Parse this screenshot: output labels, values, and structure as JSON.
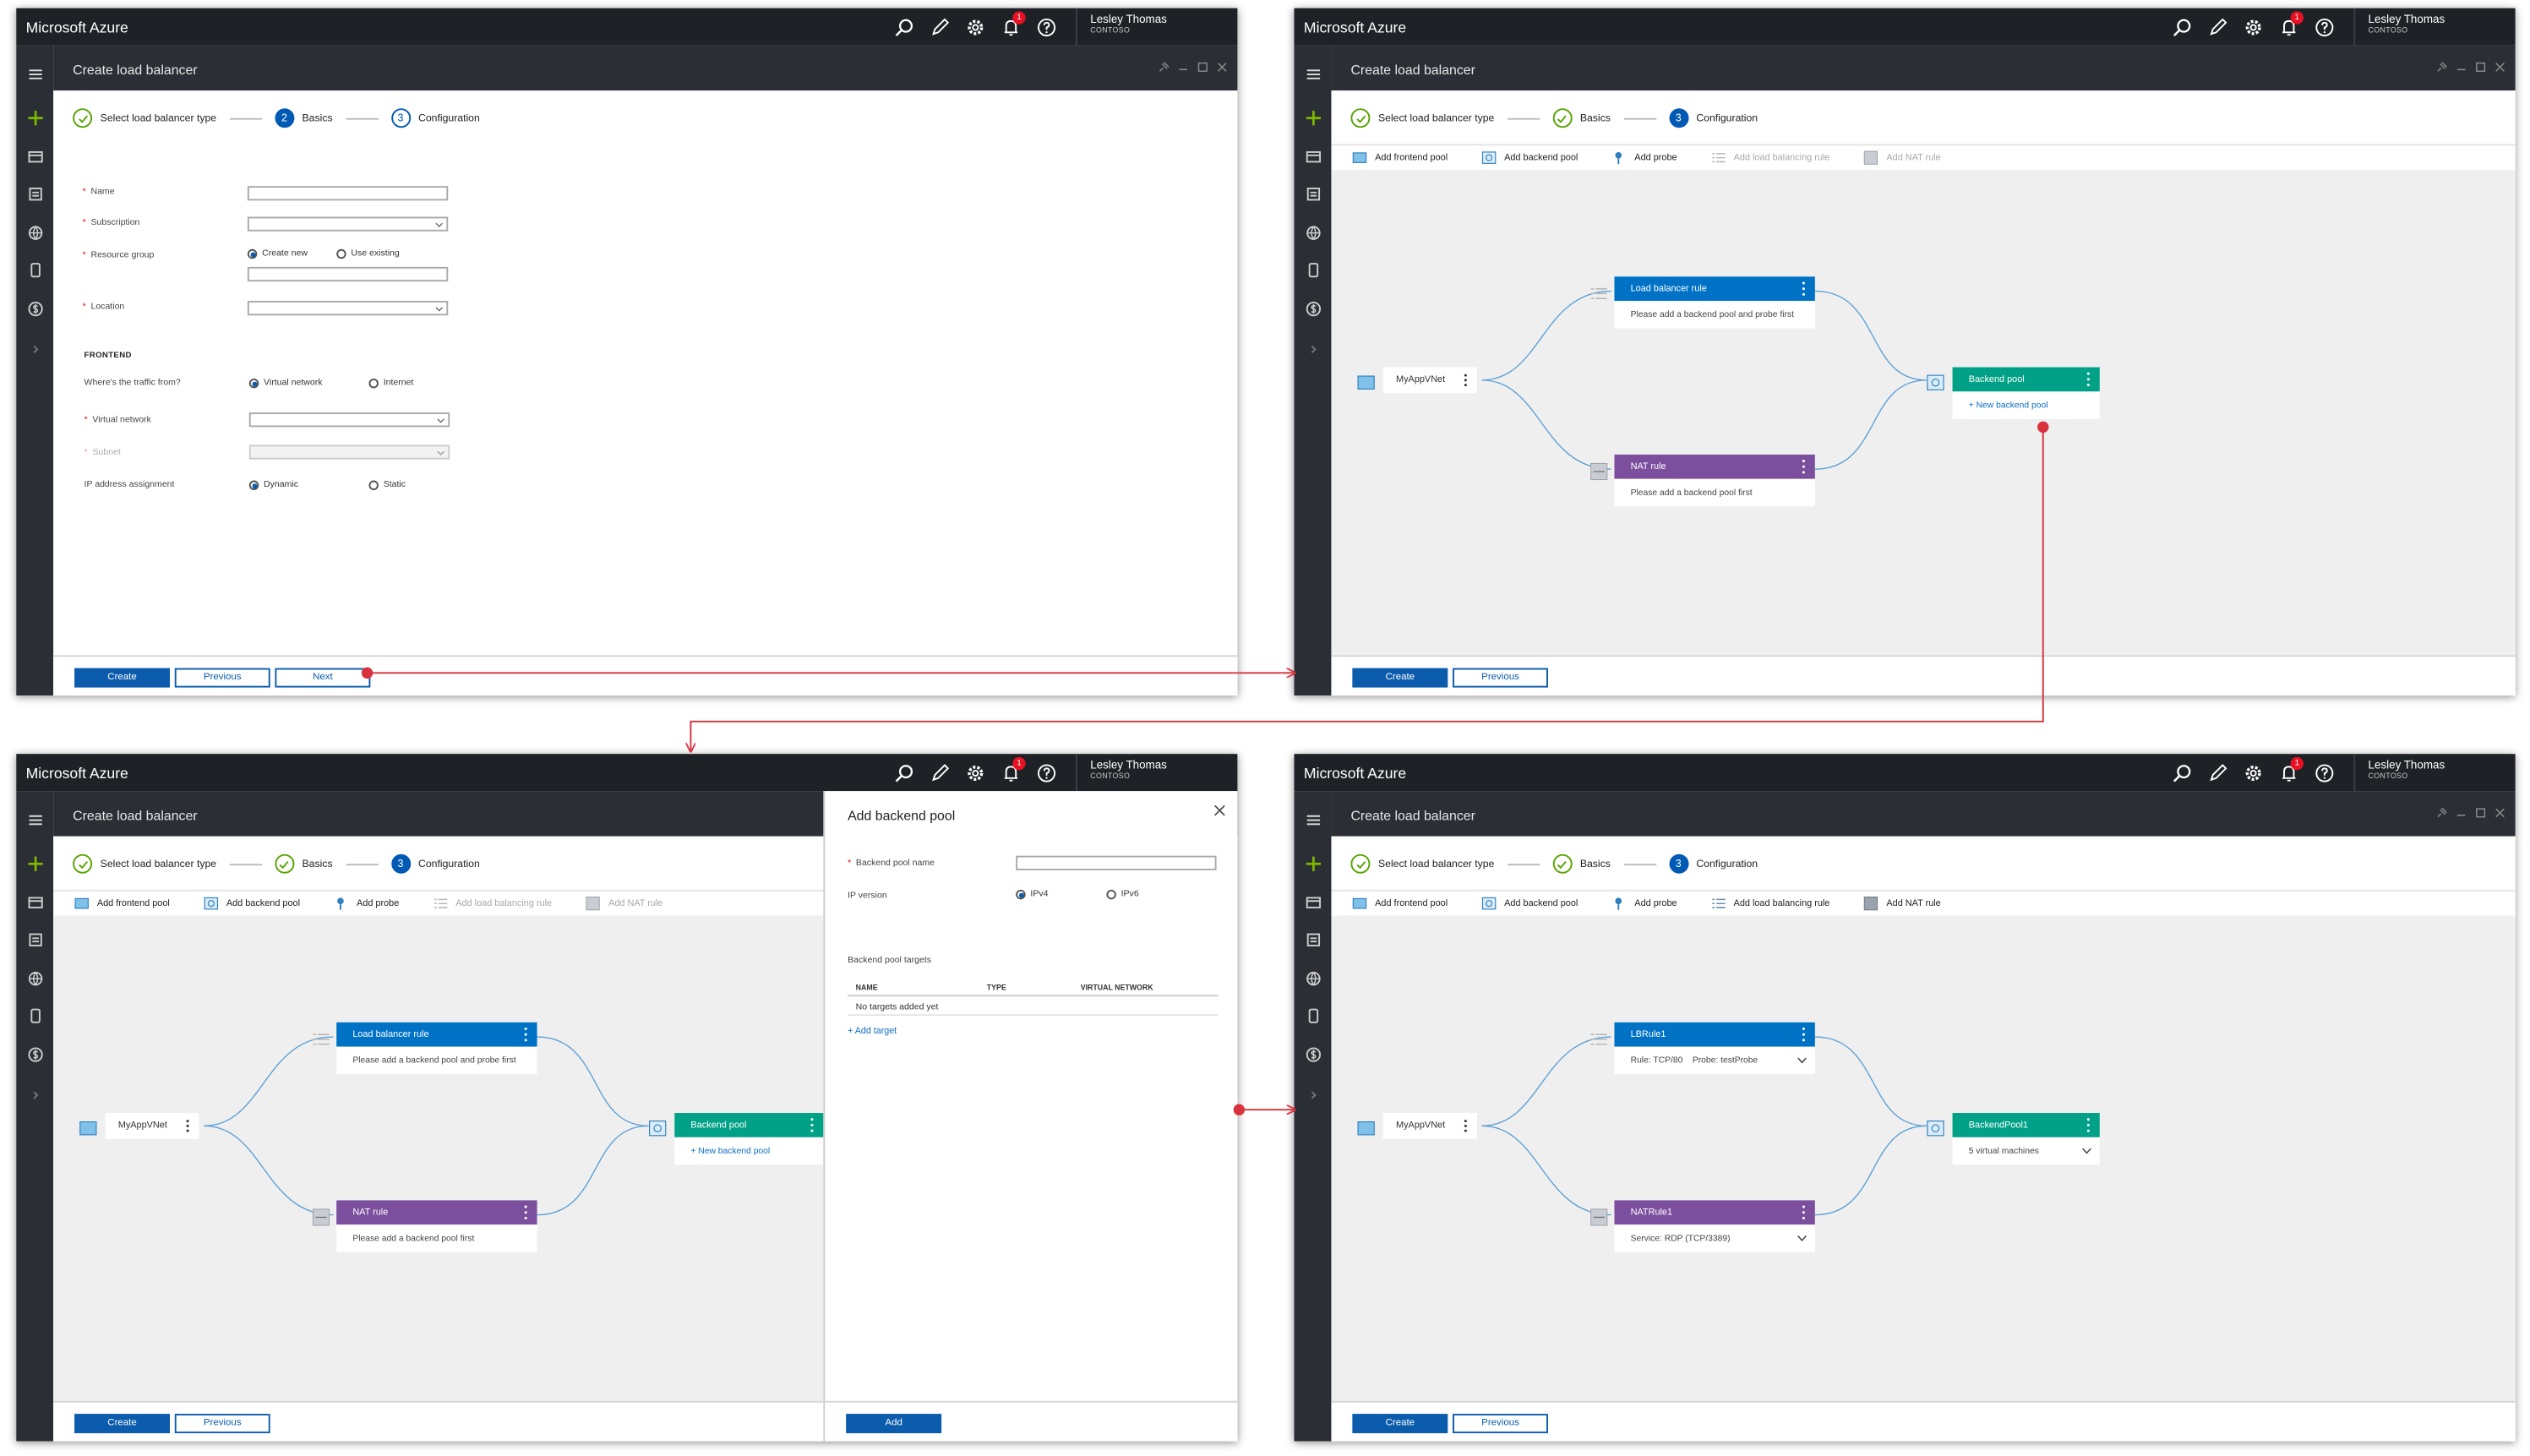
{
  "shell": {
    "brand": "Microsoft Azure",
    "notification_count": "1",
    "user_name": "Lesley Thomas",
    "user_tenant": "CONTOSO",
    "blade_title": "Create load balancer"
  },
  "steps": {
    "step1": "Select load balancer type",
    "step2": "Basics",
    "step3": "Configuration",
    "step2_number": "2",
    "step3_number": "3"
  },
  "form": {
    "name_label": "Name",
    "subscription_label": "Subscription",
    "resource_group_label": "Resource group",
    "create_new": "Create new",
    "use_existing": "Use existing",
    "location_label": "Location",
    "section_frontend": "FRONTEND",
    "traffic_label": "Where's the traffic from?",
    "virtual_network_option": "Virtual network",
    "internet_option": "Internet",
    "virtual_network_label": "Virtual network",
    "subnet_label": "Subnet",
    "ip_assignment_label": "IP address assignment",
    "dynamic_option": "Dynamic",
    "static_option": "Static"
  },
  "toolbar": {
    "add_frontend_pool": "Add frontend pool",
    "add_backend_pool": "Add backend pool",
    "add_probe": "Add probe",
    "add_lb_rule": "Add load balancing rule",
    "add_nat_rule": "Add NAT rule"
  },
  "buttons": {
    "create": "Create",
    "previous": "Previous",
    "next": "Next",
    "add": "Add"
  },
  "diagram": {
    "vnet_name": "MyAppVNet",
    "lb_rule_title": "Load balancer rule",
    "lb_rule_note": "Please add a backend pool and probe first",
    "nat_rule_title": "NAT rule",
    "nat_rule_note": "Please add a backend pool first",
    "backend_pool_title": "Backend pool",
    "new_backend_pool": "+ New backend pool"
  },
  "configured": {
    "lb_rule_name": "LBRule1",
    "lb_rule_detail": "Rule: TCP/80    Probe: testProbe",
    "nat_rule_name": "NATRule1",
    "nat_rule_detail": "Service: RDP (TCP/3389)",
    "backend_pool_name": "BackendPool1",
    "backend_pool_detail": "5 virtual machines"
  },
  "flyout": {
    "title": "Add backend pool",
    "pool_name_label": "Backend pool name",
    "ip_version_label": "IP version",
    "ipv4": "IPv4",
    "ipv6": "IPv6",
    "targets_label": "Backend pool targets",
    "col_name": "NAME",
    "col_type": "TYPE",
    "col_vnet": "VIRTUAL NETWORK",
    "empty_row": "No targets added yet",
    "add_target": "+ Add target"
  },
  "colors": {
    "accent": "#0072c6",
    "nat": "#7b4f9e",
    "pool": "#00a186",
    "flow_arrow": "#d9323e",
    "topbar": "#1e2126",
    "sidebar": "#2b2f35"
  }
}
